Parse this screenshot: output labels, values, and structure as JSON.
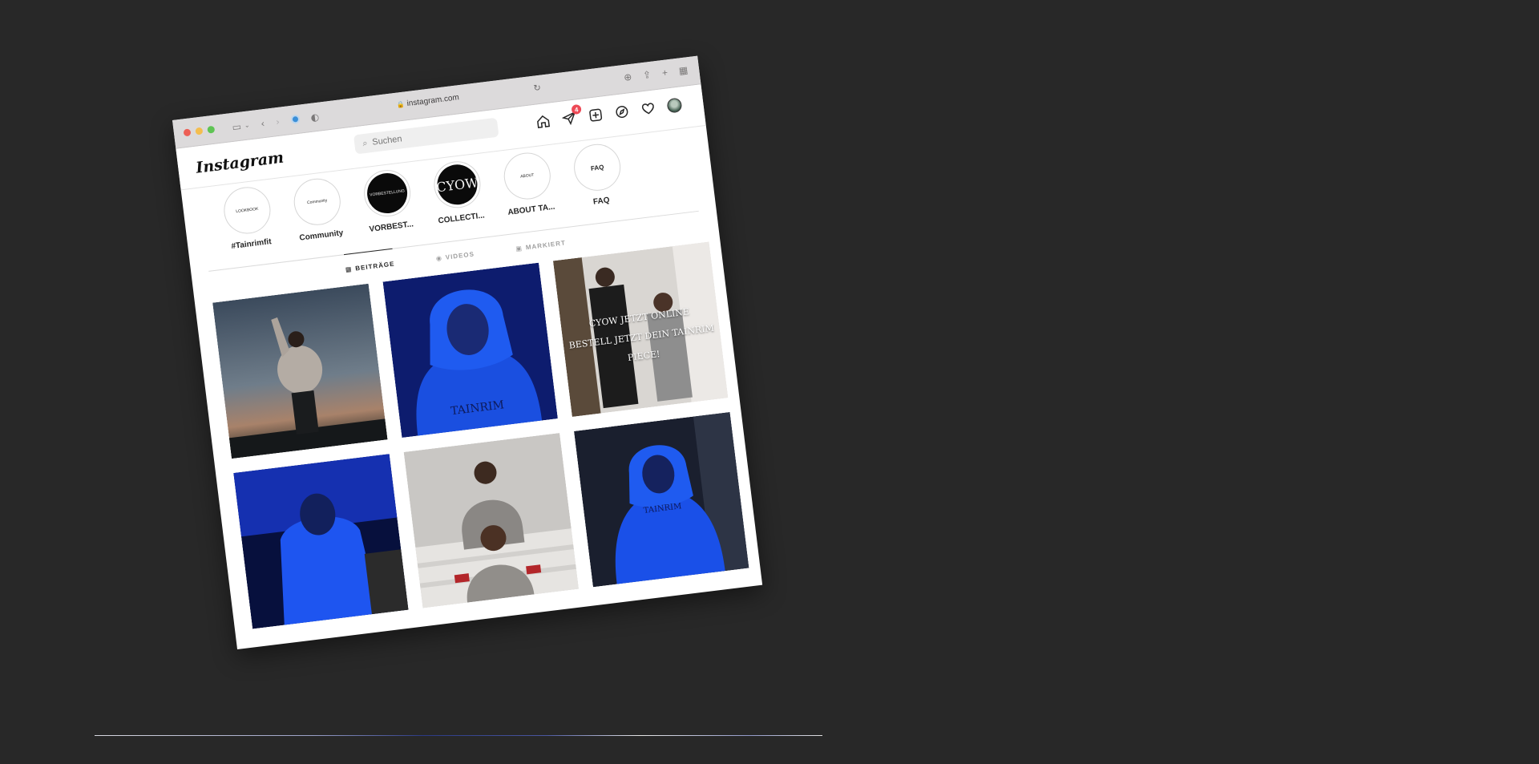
{
  "browser": {
    "url": "instagram.com"
  },
  "instagram": {
    "logo": "Instagram",
    "search_placeholder": "Suchen",
    "notification_count": "4"
  },
  "highlights": [
    {
      "label": "#Tainrimfit",
      "cover": "LOOKBOOK"
    },
    {
      "label": "Community",
      "cover": "Community"
    },
    {
      "label": "VORBEST...",
      "cover": "VORBESTELLUNG"
    },
    {
      "label": "COLLECTI...",
      "cover": "CYOW"
    },
    {
      "label": "ABOUT TA...",
      "cover": "ABOUT"
    },
    {
      "label": "FAQ",
      "cover": "FAQ"
    }
  ],
  "tabs": [
    {
      "label": "BEITRÄGE",
      "active": true
    },
    {
      "label": "VIDEOS",
      "active": false
    },
    {
      "label": "MARKIERT",
      "active": false
    }
  ],
  "posts": {
    "p2_brand": "TAINRIM",
    "p3_overlay_1": "CYOW JETZT ONLINE",
    "p3_overlay_2": "BESTELL JETZT DEIN TAINRIM",
    "p3_overlay_3": "PIECE!",
    "p6_brand": "TAINRIM"
  }
}
